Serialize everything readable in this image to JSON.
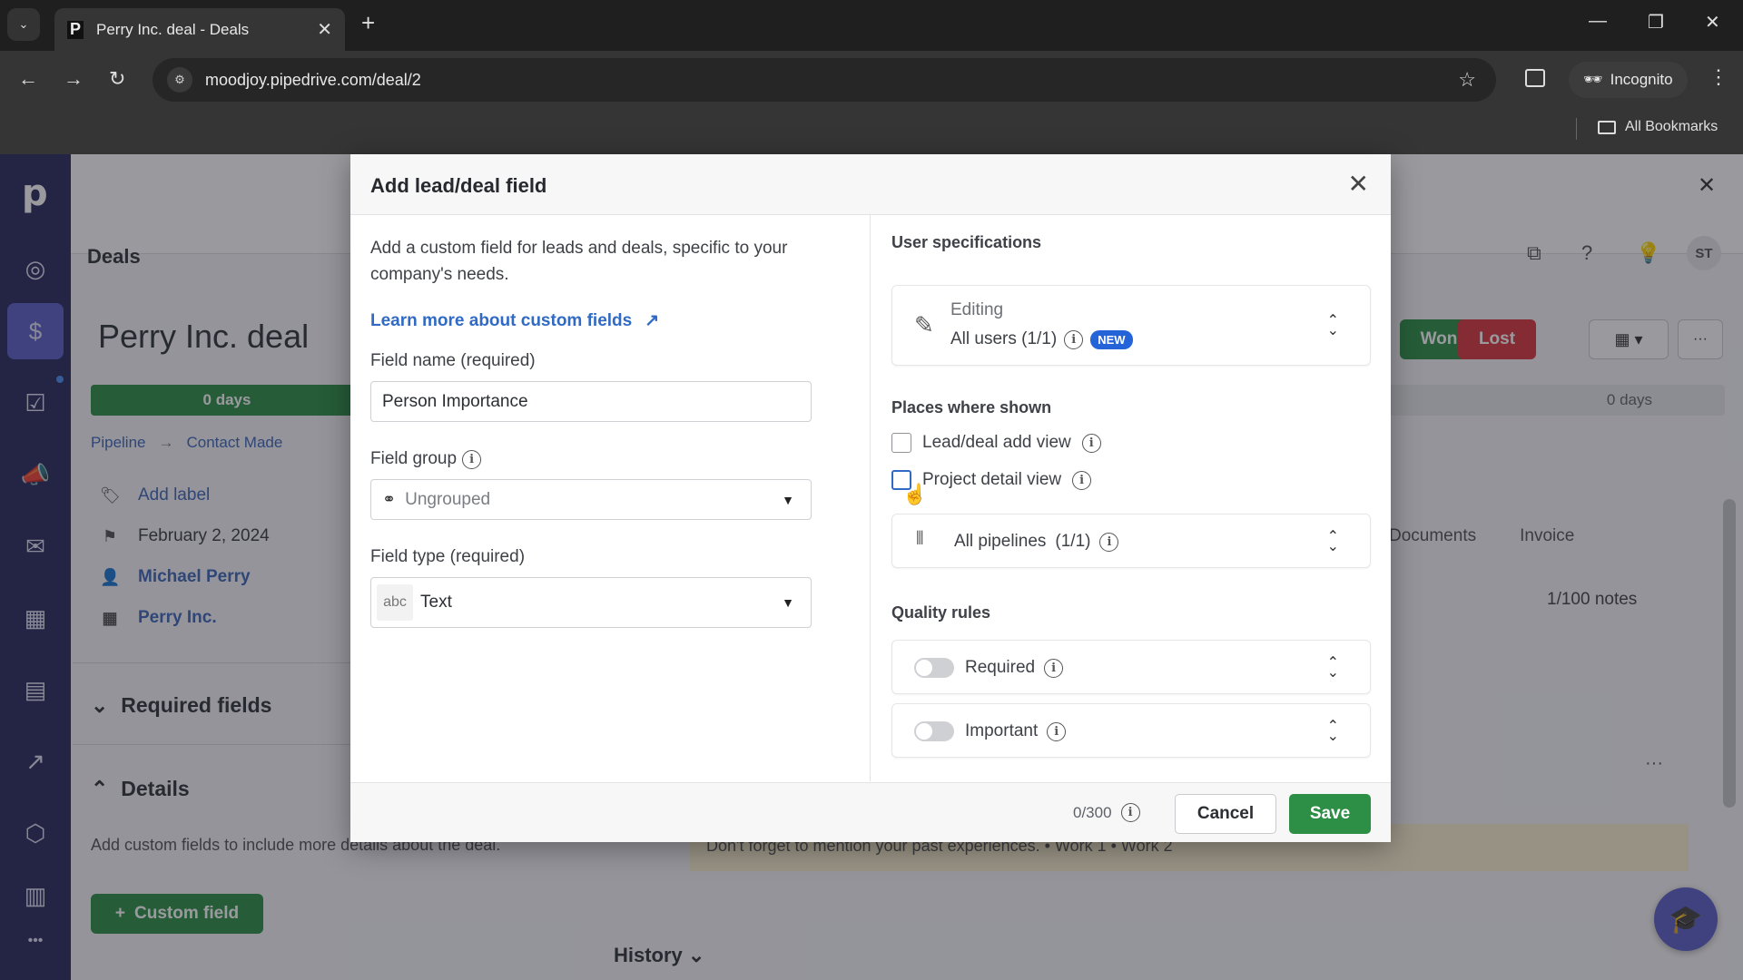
{
  "browser": {
    "tab_title": "Perry Inc. deal - Deals",
    "tab_favicon": "P",
    "url": "moodjoy.pipedrive.com/deal/2",
    "profile_label": "Incognito",
    "bookmarks_label": "All Bookmarks"
  },
  "sidebar": {
    "logo": "p",
    "items": [
      {
        "name": "leads",
        "icon": "target-icon",
        "glyph": "◎"
      },
      {
        "name": "deals",
        "icon": "dollar-icon",
        "glyph": "$",
        "active": true
      },
      {
        "name": "activities",
        "icon": "clipboard-check-icon",
        "glyph": "☑"
      },
      {
        "name": "campaigns",
        "icon": "megaphone-icon",
        "glyph": "📣"
      },
      {
        "name": "mail",
        "icon": "mail-icon",
        "glyph": "✉"
      },
      {
        "name": "calendar",
        "icon": "calendar-icon",
        "glyph": "▦"
      },
      {
        "name": "contacts",
        "icon": "contact-card-icon",
        "glyph": "▤"
      },
      {
        "name": "insights",
        "icon": "chart-icon",
        "glyph": "↗"
      },
      {
        "name": "products",
        "icon": "box-icon",
        "glyph": "⬡"
      },
      {
        "name": "marketplace",
        "icon": "tools-icon",
        "glyph": "▥"
      },
      {
        "name": "more",
        "icon": "more-icon",
        "glyph": "•••"
      }
    ]
  },
  "page": {
    "section": "Deals",
    "deal_title": "Perry Inc. deal",
    "stage_days_first": "0 days",
    "stage_days_last": "0 days",
    "breadcrumb": [
      "Pipeline",
      "Contact Made"
    ],
    "add_label": "Add label",
    "date": "February 2, 2024",
    "person": "Michael Perry",
    "organization": "Perry Inc.",
    "required_fields": "Required fields",
    "details": "Details",
    "details_text": "Add custom fields to include more details about the deal.",
    "custom_field_btn": "Custom field",
    "won": "Won",
    "lost": "Lost",
    "avatar": "ST",
    "tabs": [
      "Documents",
      "Invoice"
    ],
    "notes_count": "1/100 notes",
    "note_text": "Don't forget to mention your past experiences. • Work 1 • Work 2",
    "history": "History",
    "notification_count": "?"
  },
  "modal": {
    "title": "Add lead/deal field",
    "intro": "Add a custom field for leads and deals, specific to your company's needs.",
    "learn_more": "Learn more about custom fields",
    "field_name_label": "Field name (required)",
    "field_name_value": "Person Importance",
    "field_group_label": "Field group",
    "field_group_value": "Ungrouped",
    "field_type_label": "Field type (required)",
    "field_type_badge": "abc",
    "field_type_value": "Text",
    "user_spec_heading": "User specifications",
    "editing_label": "Editing",
    "editing_value": "All users (1/1)",
    "new_badge": "NEW",
    "places_heading": "Places where shown",
    "places": [
      {
        "label": "Lead/deal add view",
        "checked": false
      },
      {
        "label": "Project detail view",
        "checked": false
      }
    ],
    "pipelines_label": "All pipelines",
    "pipelines_count": "(1/1)",
    "quality_heading": "Quality rules",
    "rules": [
      {
        "label": "Required",
        "enabled": false
      },
      {
        "label": "Important",
        "enabled": false
      }
    ],
    "char_counter": "0/300",
    "cancel": "Cancel",
    "save": "Save"
  }
}
